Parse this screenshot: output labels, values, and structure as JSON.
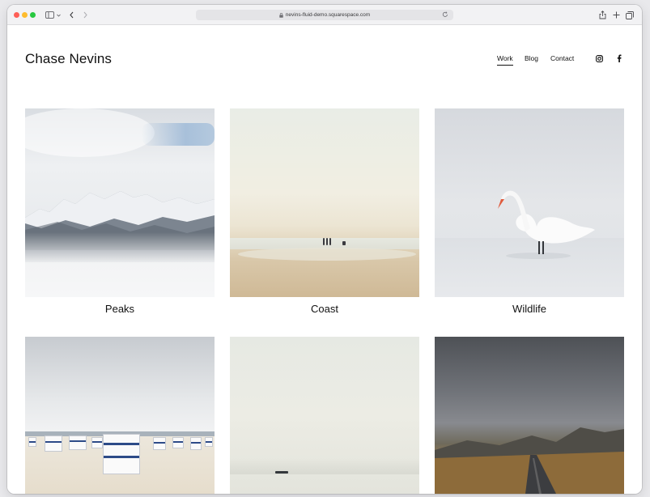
{
  "browser": {
    "url": "nevins-fluid-demo.squarespace.com"
  },
  "site": {
    "title": "Chase Nevins",
    "nav": [
      "Work",
      "Blog",
      "Contact"
    ],
    "active_nav": "Work"
  },
  "gallery": [
    {
      "caption": "Peaks"
    },
    {
      "caption": "Coast"
    },
    {
      "caption": "Wildlife"
    },
    {
      "caption": ""
    },
    {
      "caption": ""
    },
    {
      "caption": ""
    }
  ],
  "icons": {
    "social": [
      "instagram-icon",
      "facebook-icon"
    ]
  },
  "colors": {
    "text": "#111111",
    "background": "#ffffff"
  }
}
